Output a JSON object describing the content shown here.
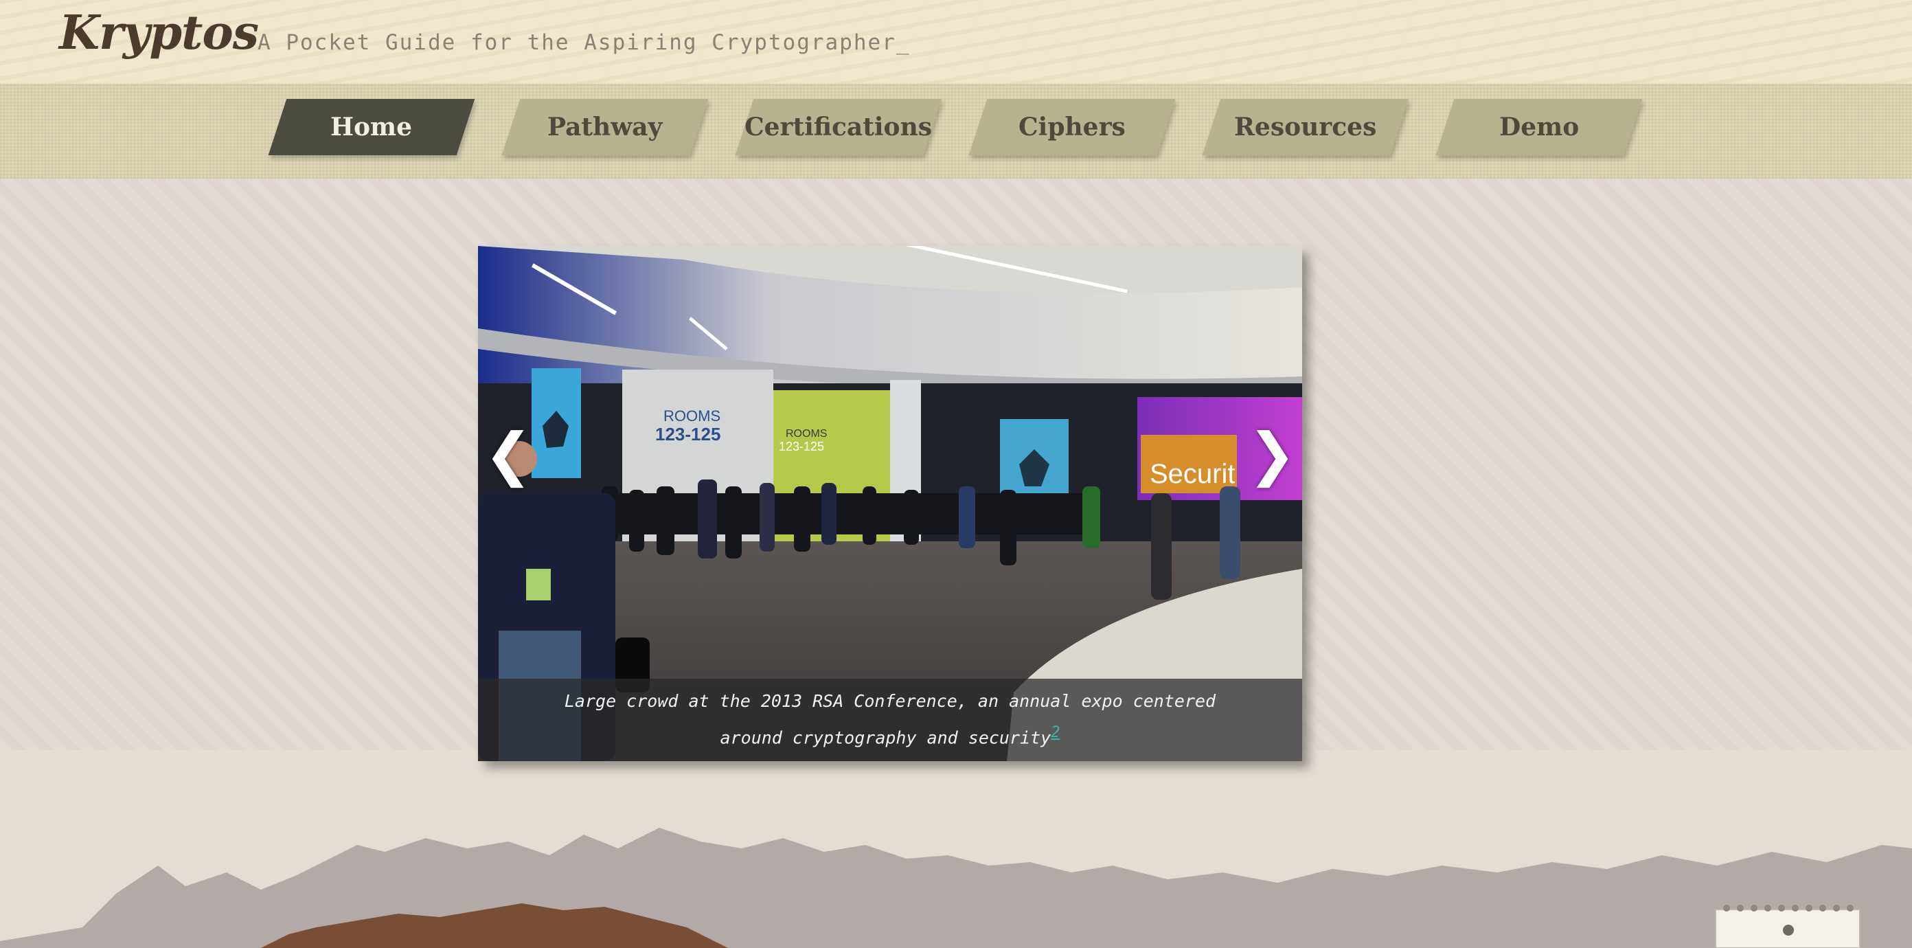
{
  "header": {
    "logo": "Kryptos",
    "tagline": "A Pocket Guide for the Aspiring Cryptographer_"
  },
  "nav": {
    "tabs": [
      {
        "label": "Home",
        "active": true
      },
      {
        "label": "Pathway",
        "active": false
      },
      {
        "label": "Certifications",
        "active": false
      },
      {
        "label": "Ciphers",
        "active": false
      },
      {
        "label": "Resources",
        "active": false
      },
      {
        "label": "Demo",
        "active": false
      }
    ]
  },
  "slideshow": {
    "prev_icon": "chevron-left-icon",
    "next_icon": "chevron-right-icon",
    "prev_glyph": "❮",
    "next_glyph": "❯",
    "caption": "Large crowd at the 2013 RSA Conference, an annual expo centered around cryptography and security",
    "caption_ref": "2",
    "banners": {
      "rooms_title_1": "ROOMS",
      "rooms_number_1": "123-125",
      "rooms_title_2": "ROOMS",
      "rooms_number_2": "123-125",
      "sign_security": "Securit"
    }
  },
  "colors": {
    "nav_active": "#4c4b3f",
    "nav_inactive": "#b7b38f",
    "caption_link": "#37b5a9",
    "logo": "#4b3b2c"
  }
}
